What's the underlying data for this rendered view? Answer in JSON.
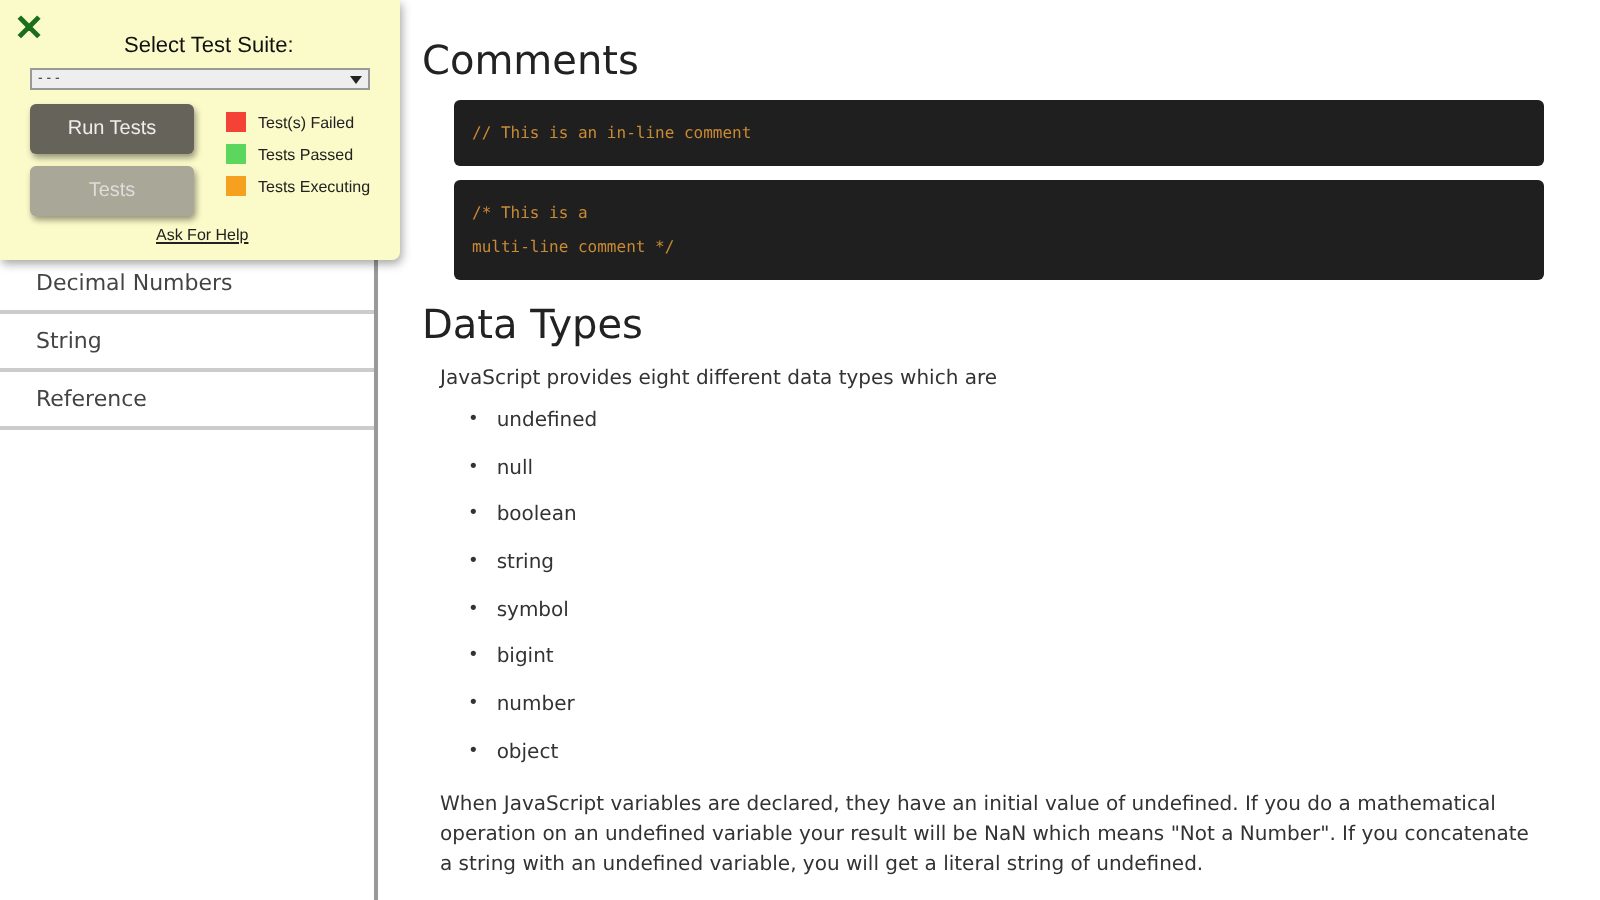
{
  "test_panel": {
    "close": "✕",
    "suite_label": "Select Test Suite:",
    "suite_select": {
      "value": "- - -"
    },
    "buttons": [
      {
        "label": "Run Tests",
        "disabled": false
      },
      {
        "label": "Tests",
        "disabled": true
      }
    ],
    "legend": [
      {
        "label": "Test(s) Failed",
        "color": "#f44336"
      },
      {
        "label": "Tests Passed",
        "color": "#5cd65c"
      },
      {
        "label": "Tests Executing",
        "color": "#f5a01f"
      }
    ],
    "help_link": "Ask For Help"
  },
  "sidebar": {
    "items": [
      "Decimal Numbers",
      "String",
      "Reference"
    ]
  },
  "content": {
    "sections": [
      {
        "heading": "Comments",
        "blocks": [
          {
            "kind": "code",
            "lines": [
              "// This is an in-line comment"
            ]
          },
          {
            "kind": "code",
            "lines": [
              "/* This is a",
              "multi-line comment */"
            ]
          }
        ]
      },
      {
        "heading": "Data Types",
        "blocks": [
          {
            "kind": "paragraph",
            "text": "JavaScript provides eight different data types which are"
          },
          {
            "kind": "list",
            "marker": "•",
            "items": [
              "undefined",
              "null",
              "boolean",
              "string",
              "symbol",
              "bigint",
              "number",
              "object"
            ]
          },
          {
            "kind": "paragraph",
            "text": "When JavaScript variables are declared, they have an initial value of undefined. If you do a mathematical operation on an undefined variable your result will be NaN which means \"Not a Number\". If you concatenate a string with an undefined variable, you will get a literal string of undefined."
          }
        ]
      }
    ]
  }
}
